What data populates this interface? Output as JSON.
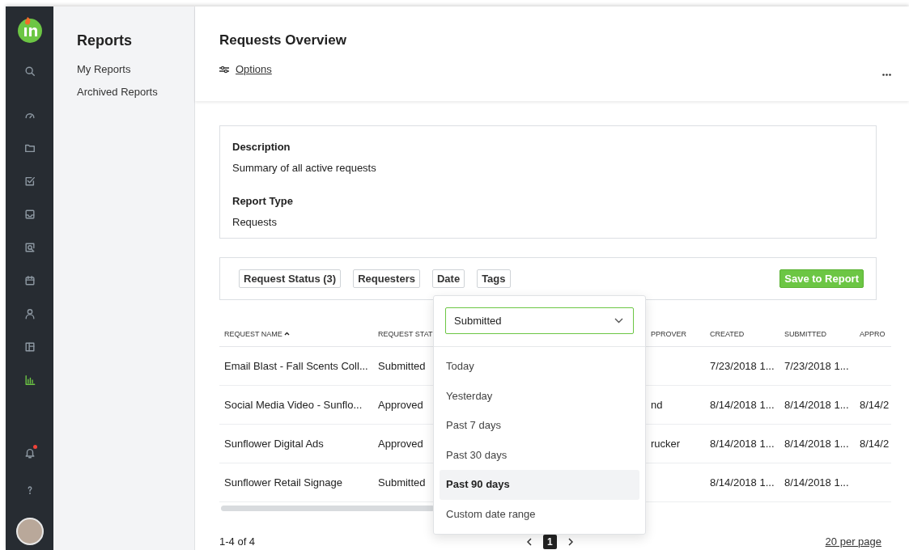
{
  "rail": {
    "items": [
      {
        "kind": "search",
        "selected": false
      },
      {
        "kind": "gauge",
        "selected": false
      },
      {
        "kind": "folder",
        "selected": false
      },
      {
        "kind": "task",
        "selected": false
      },
      {
        "kind": "inbox",
        "selected": false
      },
      {
        "kind": "review",
        "selected": false
      },
      {
        "kind": "calendar",
        "selected": false
      },
      {
        "kind": "person",
        "selected": false
      },
      {
        "kind": "layout",
        "selected": false
      },
      {
        "kind": "chart",
        "selected": true
      }
    ],
    "bottom": [
      {
        "kind": "bell",
        "selected": false,
        "alert": true
      },
      {
        "kind": "help",
        "selected": false
      }
    ]
  },
  "sidebar": {
    "title": "Reports",
    "items": [
      {
        "label": "My Reports"
      },
      {
        "label": "Archived Reports"
      }
    ]
  },
  "header": {
    "title": "Requests Overview",
    "options_link": "Options"
  },
  "description": {
    "sections": [
      {
        "label": "Description",
        "value": "Summary of all active requests"
      },
      {
        "label": "Report Type",
        "value": "Requests"
      }
    ]
  },
  "filters": {
    "chips": [
      "Request Status (3)",
      "Requesters",
      "Date",
      "Tags"
    ],
    "save_button": "Save to Report"
  },
  "date_menu": {
    "select_value": "Submitted",
    "options": [
      {
        "label": "Today",
        "selected": false
      },
      {
        "label": "Yesterday",
        "selected": false
      },
      {
        "label": "Past 7 days",
        "selected": false
      },
      {
        "label": "Past 30 days",
        "selected": false
      },
      {
        "label": "Past 90 days",
        "selected": true
      },
      {
        "label": "Custom date range",
        "selected": false
      }
    ]
  },
  "table": {
    "columns": [
      {
        "label": "REQUEST NAME",
        "sorted": true
      },
      {
        "label": "REQUEST STAT",
        "sorted": false
      },
      {
        "label": "PPROVER",
        "sorted": false
      },
      {
        "label": "CREATED",
        "sorted": false
      },
      {
        "label": "SUBMITTED",
        "sorted": false
      },
      {
        "label": "APPRO",
        "sorted": false
      }
    ],
    "rows": [
      {
        "cells": [
          "Email Blast - Fall Scents Coll...",
          "Submitted",
          null,
          "7/23/2018 1...",
          "7/23/2018 1...",
          null
        ]
      },
      {
        "cells": [
          "Social Media Video - Sunflo...",
          "Approved",
          "nd",
          "8/14/2018 1...",
          "8/14/2018 1...",
          "8/14/2"
        ]
      },
      {
        "cells": [
          "Sunflower Digital Ads",
          "Approved",
          "rucker",
          "8/14/2018 1...",
          "8/14/2018 1...",
          "8/14/2"
        ]
      },
      {
        "cells": [
          "Sunflower Retail Signage",
          "Submitted",
          null,
          "8/14/2018 1...",
          "8/14/2018 1...",
          null
        ]
      }
    ]
  },
  "pager": {
    "range": "1-4 of 4",
    "pages": [
      {
        "label": "1",
        "selected": true
      }
    ],
    "per_page": "20 per page"
  }
}
